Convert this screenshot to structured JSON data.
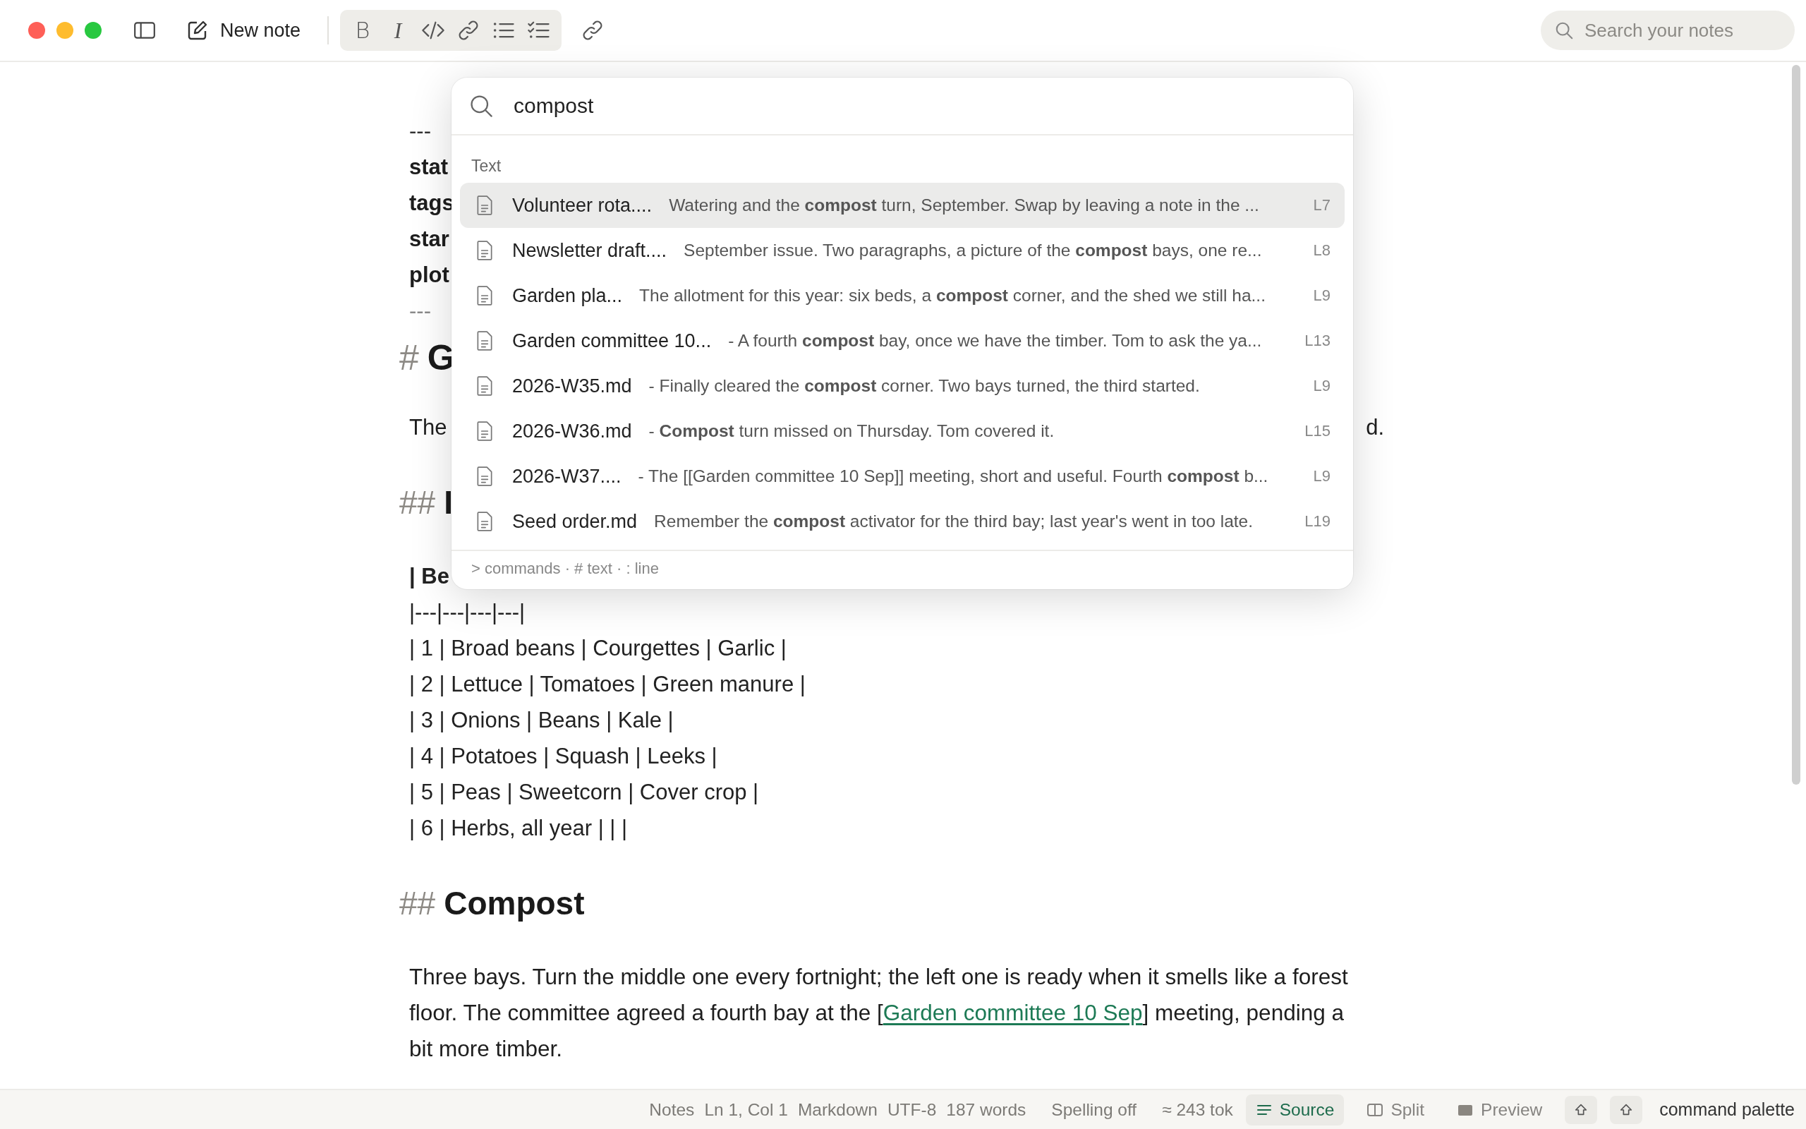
{
  "toolbar": {
    "new_note": "New note",
    "format_buttons": [
      {
        "kind": "bold",
        "label": "B"
      },
      {
        "kind": "italic",
        "label": "I"
      },
      {
        "kind": "code"
      },
      {
        "kind": "link"
      },
      {
        "kind": "bullets"
      },
      {
        "kind": "checklist"
      }
    ],
    "search": {
      "placeholder": "Search your notes"
    }
  },
  "editor": {
    "frontmatter": {
      "open": "---",
      "keys": [
        "stat",
        "tags",
        "star",
        "plot"
      ],
      "close": "---"
    },
    "blocks": [
      {
        "kind": "heading",
        "marker": "#",
        "text": "G"
      },
      {
        "kind": "fragment",
        "text": "The",
        "tail": "d."
      },
      {
        "kind": "heading",
        "marker": "##",
        "text": "I"
      },
      {
        "kind": "table",
        "header": "| Be",
        "separator": "|---|---|---|---|",
        "rows": [
          "| 1 | Broad beans | Courgettes | Garlic |",
          "| 2 | Lettuce | Tomatoes | Green manure |",
          "| 3 | Onions | Beans | Kale |",
          "| 4 | Potatoes | Squash | Leeks |",
          "| 5 | Peas | Sweetcorn | Cover crop |",
          "| 6 | Herbs, all year | | |"
        ]
      },
      {
        "kind": "heading",
        "marker": "##",
        "text": "Compost"
      },
      {
        "kind": "paragraph",
        "before": "Three bays. Turn the middle one every fortnight; the left one is ready when it smells like a forest floor. The committee agreed a fourth bay at the [",
        "link": "Garden committee 10 Sep",
        "after": "] meeting, pending a bit more timber."
      }
    ]
  },
  "palette": {
    "query": "compost",
    "section": "Text",
    "results": [
      {
        "title": "Volunteer rota....",
        "snippet": "Watering and the **compost** turn, September. Swap by leaving a note in the ...",
        "line": "L7",
        "selected": true
      },
      {
        "title": "Newsletter draft....",
        "snippet": "September issue. Two paragraphs, a picture of the **compost** bays, one re...",
        "line": "L8",
        "selected": false
      },
      {
        "title": "Garden pla...",
        "snippet": "The allotment for this year: six beds, a **compost** corner, and the shed we still ha...",
        "line": "L9",
        "selected": false
      },
      {
        "title": "Garden committee 10...",
        "snippet": "- A fourth **compost** bay, once we have the timber. Tom to ask the ya...",
        "line": "L13",
        "selected": false
      },
      {
        "title": "2026-W35.md",
        "snippet": "- Finally cleared the **compost** corner. Two bays turned, the third started.",
        "line": "L9",
        "selected": false
      },
      {
        "title": "2026-W36.md",
        "snippet": "- **Compost** turn missed on Thursday. Tom covered it.",
        "line": "L15",
        "selected": false
      },
      {
        "title": "2026-W37....",
        "snippet": "- The [[Garden committee 10 Sep]] meeting, short and useful. Fourth **compost** b...",
        "line": "L9",
        "selected": false
      },
      {
        "title": "Seed order.md",
        "snippet": "Remember the **compost** activator for the third bay; last year's went in too late.",
        "line": "L19",
        "selected": false
      }
    ],
    "footer": "> commands · # text · : line"
  },
  "status_bar": {
    "items": [
      "Notes",
      "Ln 1, Col 1",
      "Markdown",
      "UTF-8",
      "187 words"
    ],
    "spelling": "Spelling off",
    "tokens": "≈ 243 tok",
    "views": [
      {
        "kind": "source",
        "label": "Source",
        "selected": true
      },
      {
        "kind": "split",
        "label": "Split",
        "selected": false
      },
      {
        "kind": "preview",
        "label": "Preview",
        "selected": false
      }
    ],
    "command": "command palette"
  }
}
